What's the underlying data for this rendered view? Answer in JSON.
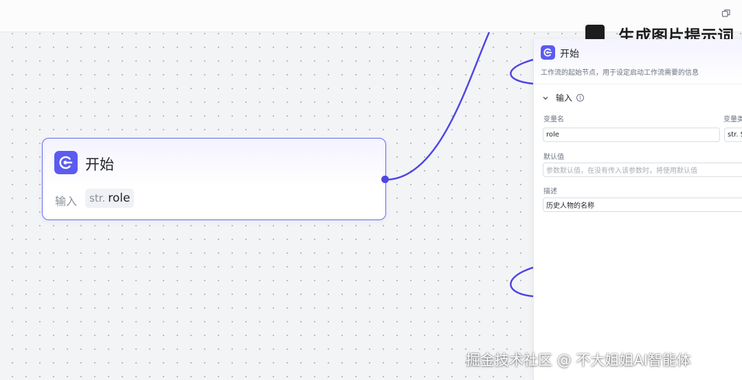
{
  "start_node": {
    "title": "开始",
    "input_label": "输入",
    "param_type": "str.",
    "param_name": "role"
  },
  "background_node": {
    "title": "生成图片提示词"
  },
  "panel": {
    "title": "开始",
    "description": "工作流的起始节点，用于设定启动工作流需要的信息",
    "section_label": "输入",
    "info_glyph": "i",
    "var_name_label": "变量名",
    "var_type_label": "变量类",
    "var_name_value": "role",
    "var_type_value": "str. S",
    "default_label": "默认值",
    "default_placeholder": "参数默认值，在没有传入该参数时，将使用默认值",
    "desc_label": "描述",
    "desc_value": "历史人物的名称"
  },
  "watermark": "掘金技术社区 @ 不大姐姐AI智能体",
  "colors": {
    "accent": "#5b5bf0",
    "edge": "#4f46e5"
  },
  "icons": [
    "start-node-icon",
    "restore-window-icon",
    "chevron-down-icon",
    "info-icon"
  ]
}
